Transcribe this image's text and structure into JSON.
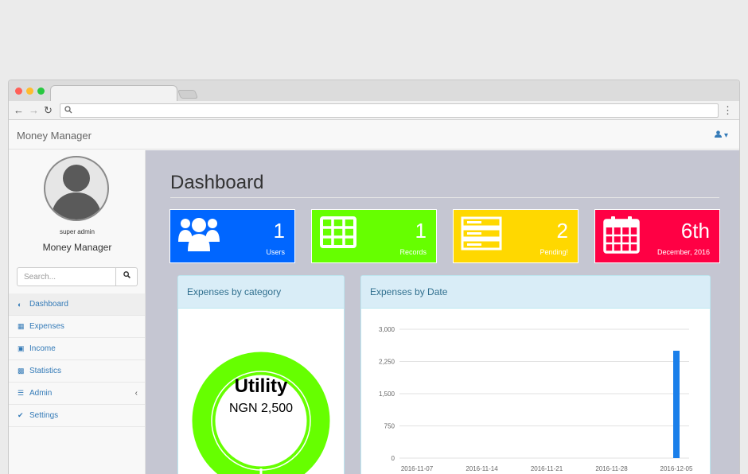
{
  "app": {
    "brand": "Money Manager"
  },
  "colors": {
    "users": "#0066ff",
    "records": "#66ff00",
    "pending": "#ffd800",
    "date": "#ff0044",
    "chart_bar": "#1a7fea",
    "donut": "#66ff00"
  },
  "sidebar": {
    "role": "super admin",
    "name": "Money Manager",
    "search_placeholder": "Search...",
    "items": [
      {
        "label": "Dashboard",
        "icon": "dashboard-icon"
      },
      {
        "label": "Expenses",
        "icon": "table-icon"
      },
      {
        "label": "Income",
        "icon": "money-icon"
      },
      {
        "label": "Statistics",
        "icon": "bar-chart-icon"
      },
      {
        "label": "Admin",
        "icon": "database-icon"
      },
      {
        "label": "Settings",
        "icon": "wrench-icon"
      }
    ]
  },
  "main": {
    "title": "Dashboard",
    "cards": [
      {
        "value": "1",
        "label": "Users",
        "icon": "users-icon"
      },
      {
        "value": "1",
        "label": "Records",
        "icon": "table-icon"
      },
      {
        "value": "2",
        "label": "Pending!",
        "icon": "server-icon"
      },
      {
        "value": "6th",
        "label": "December, 2016",
        "icon": "calendar-icon"
      }
    ],
    "category_panel": {
      "title": "Expenses by category",
      "center_title": "Utility",
      "center_value": "NGN 2,500"
    },
    "date_panel": {
      "title": "Expenses by Date"
    }
  },
  "chart_data": [
    {
      "type": "pie",
      "categories": [
        "Utility"
      ],
      "values": [
        2500
      ]
    },
    {
      "type": "bar",
      "x_ticks": [
        "2016-11-07",
        "2016-11-14",
        "2016-11-21",
        "2016-11-28",
        "2016-12-05"
      ],
      "y_ticks": [
        "0",
        "750",
        "1,500",
        "2,250",
        "3,000"
      ],
      "ylim": [
        0,
        3000
      ],
      "x": [
        "2016-12-05"
      ],
      "values": [
        2500
      ],
      "grid": true
    }
  ]
}
